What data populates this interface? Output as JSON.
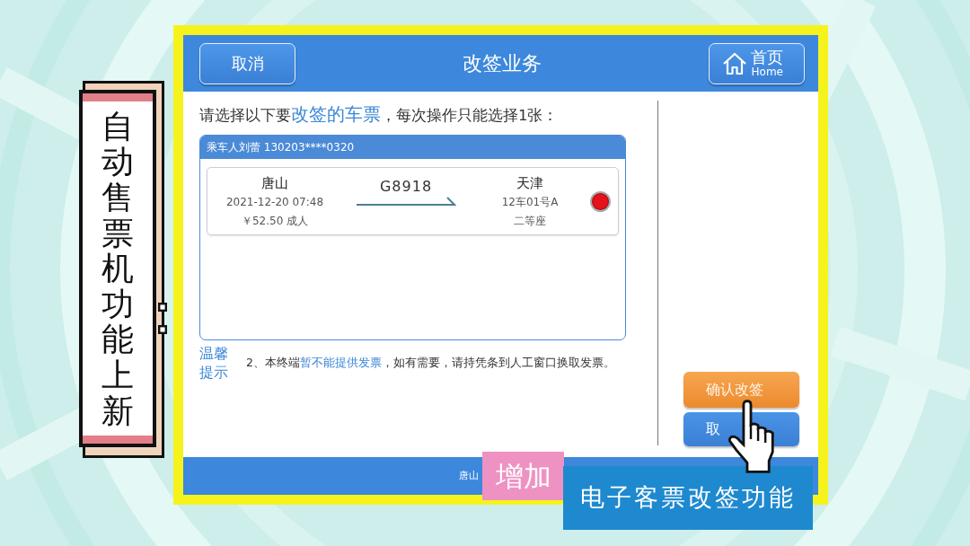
{
  "slide_title": "自动售票机功能上新",
  "kiosk": {
    "header": {
      "cancel_button": "取消",
      "title": "改签业务",
      "home_button": {
        "label": "首页",
        "sublabel": "Home"
      }
    },
    "instruction": [
      {
        "text": "请选择以下要",
        "highlight": false
      },
      {
        "text": "改签的车票",
        "highlight": true
      },
      {
        "text": "，每次操作只能选择1张：",
        "highlight": false
      }
    ],
    "ticket_card": {
      "passenger": "乘车人刘蕾 130203****0320",
      "tickets": [
        {
          "from": "唐山",
          "departure": "2021-12-20 07:48",
          "price": "￥52.50 成人",
          "train": "G8918",
          "to": "天津",
          "seat": "12车01号A",
          "seat_class": "二等座",
          "selected": true
        }
      ]
    },
    "notice": {
      "label": "温馨提示",
      "text": [
        {
          "text": "2、本终端",
          "highlight": false
        },
        {
          "text": "暂不能提供发票",
          "highlight": true
        },
        {
          "text": "，如有需要，请持凭条到人工窗口换取发票。",
          "highlight": false
        }
      ]
    },
    "actions": [
      {
        "kind": "confirm",
        "label": "确认改签"
      },
      {
        "kind": "cancel",
        "label": "取"
      }
    ],
    "footer": "唐山"
  },
  "caption": {
    "tag": "增加",
    "text": "电子客票改签功能"
  }
}
